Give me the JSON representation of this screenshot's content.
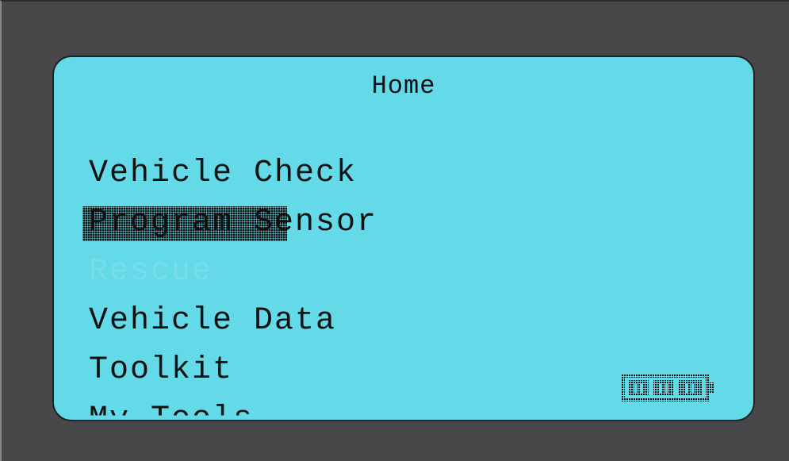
{
  "screen": {
    "title": "Home",
    "menu": [
      {
        "label": "Vehicle Check",
        "state": "normal"
      },
      {
        "label": "Program Sensor",
        "state": "selected"
      },
      {
        "label": "Rescue",
        "state": "faded"
      },
      {
        "label": "Vehicle Data",
        "state": "normal"
      },
      {
        "label": "Toolkit",
        "state": "normal"
      },
      {
        "label": "My Tools",
        "state": "clipped"
      }
    ],
    "battery": {
      "icon": "battery-icon",
      "level": 3,
      "max": 3
    }
  },
  "colors": {
    "bezel": "#48484a",
    "lcd": "#64d9e8",
    "text": "#111111"
  }
}
